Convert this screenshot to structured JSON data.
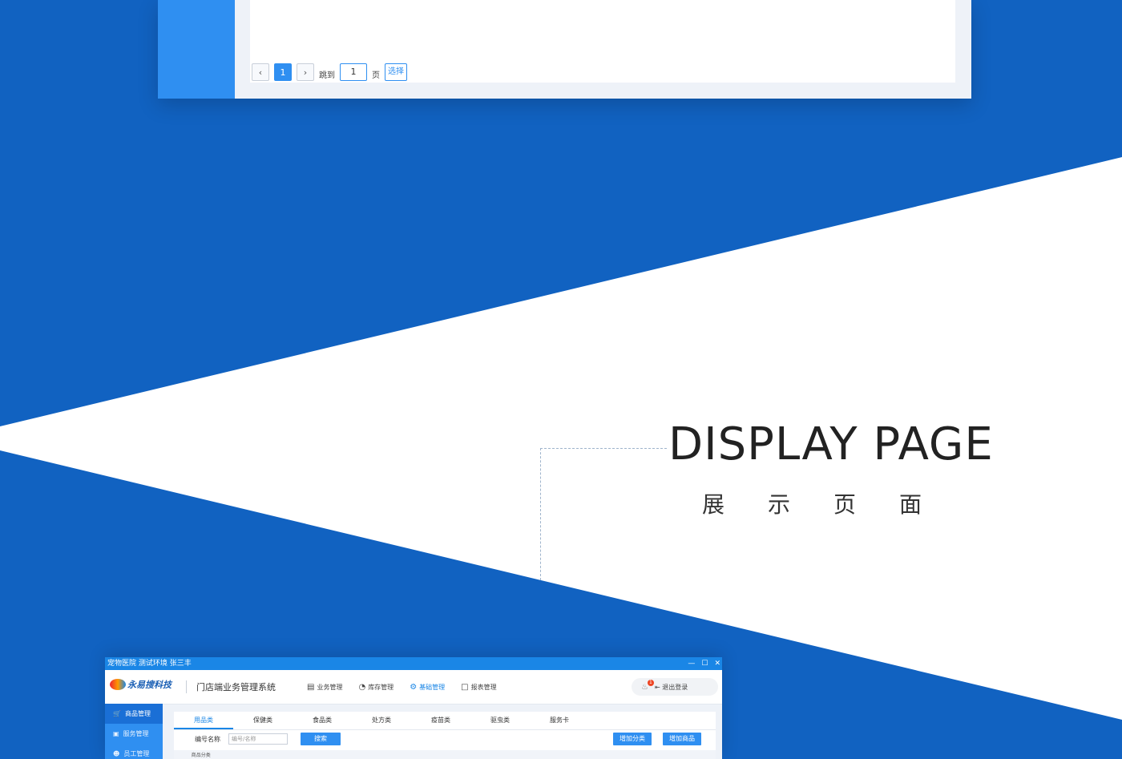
{
  "pager": {
    "prev_icon": "chevron-left-icon",
    "current_page": "1",
    "next_icon": "chevron-right-icon",
    "goto_label": "跳到",
    "goto_value": "1",
    "page_unit": "页",
    "go_label": "选择"
  },
  "hero": {
    "title": "DISPLAY PAGE",
    "subtitle": "展示页面"
  },
  "app": {
    "window_title": "宠物医院 测试环境 张三丰",
    "window_controls": [
      "—",
      "☐",
      "✕"
    ],
    "logo_text": "永易搜科技",
    "system_title": "门店端业务管理系统",
    "nav": [
      {
        "label": "业务管理",
        "icon": "briefcase-icon"
      },
      {
        "label": "库存管理",
        "icon": "pie-chart-icon"
      },
      {
        "label": "基础管理",
        "icon": "gear-icon",
        "active": true
      },
      {
        "label": "报表管理",
        "icon": "document-icon"
      }
    ],
    "notification_count": "1",
    "logout_label": "退出登录",
    "sidebar": [
      {
        "label": "商品管理",
        "icon": "cart-icon",
        "active": true
      },
      {
        "label": "服务管理",
        "icon": "bag-icon"
      },
      {
        "label": "员工管理",
        "icon": "user-icon"
      }
    ],
    "tabs": [
      "用品类",
      "保健类",
      "食品类",
      "处方类",
      "疫苗类",
      "驱虫类",
      "服务卡"
    ],
    "filter_label": "编号名称",
    "search_placeholder": "编号/名称",
    "search_button": "搜索",
    "add_category_button": "增加分类",
    "add_product_button": "增加商品",
    "table_headers": [
      "商品分类",
      "",
      "",
      "",
      "",
      "",
      "",
      "",
      "",
      "",
      ""
    ]
  },
  "colors": {
    "background_blue": "#1162c1",
    "primary": "#2f8ff1",
    "title_bar": "#1a86e6"
  }
}
